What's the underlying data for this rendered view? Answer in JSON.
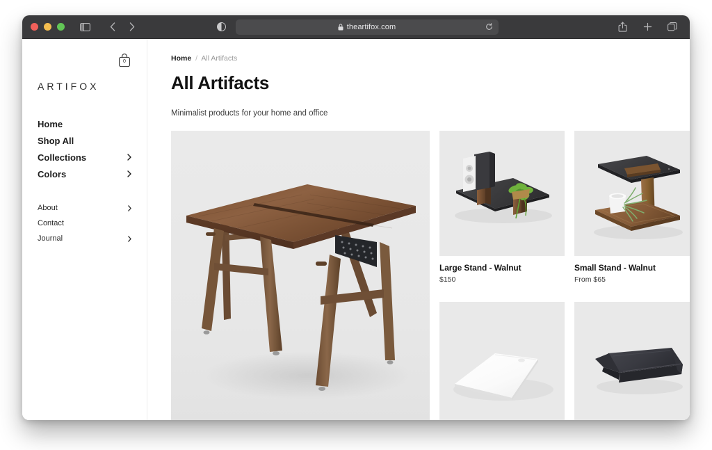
{
  "browser": {
    "window_controls": [
      "close",
      "minimize",
      "zoom"
    ],
    "sidebar_toggle_icon": "sidebar-icon",
    "back_icon": "chevron-left-icon",
    "forward_icon": "chevron-right-icon",
    "reader_icon": "reader-contrast-icon",
    "lock_icon": "lock-icon",
    "url": "theartifox.com",
    "reload_icon": "reload-icon",
    "share_icon": "share-icon",
    "new_tab_icon": "plus-icon",
    "tabs_icon": "tab-overview-icon"
  },
  "sidebar": {
    "brand": "ARTIFOX",
    "cart": {
      "icon": "shopping-bag-icon",
      "count": "0"
    },
    "primary_nav": [
      {
        "label": "Home",
        "chevron": false
      },
      {
        "label": "Shop All",
        "chevron": false
      },
      {
        "label": "Collections",
        "chevron": true
      },
      {
        "label": "Colors",
        "chevron": true
      }
    ],
    "secondary_nav": [
      {
        "label": "About",
        "chevron": true
      },
      {
        "label": "Contact",
        "chevron": false
      },
      {
        "label": "Journal",
        "chevron": true
      }
    ]
  },
  "main": {
    "breadcrumb": {
      "home": "Home",
      "separator": "/",
      "current": "All Artifacts"
    },
    "title": "All Artifacts",
    "subtitle": "Minimalist products for your home and office",
    "products": [
      {
        "image_alt": "walnut-desk",
        "name": "",
        "price": ""
      },
      {
        "image_alt": "large-stand-walnut",
        "name": "Large Stand - Walnut",
        "price": "$150"
      },
      {
        "image_alt": "small-stand-walnut",
        "name": "Small Stand - Walnut",
        "price": "From $65"
      },
      {
        "image_alt": "white-desk-mat",
        "name": "",
        "price": ""
      },
      {
        "image_alt": "black-tray-ledge",
        "name": "",
        "price": ""
      }
    ]
  },
  "colors": {
    "toolbar_bg": "#3a3a3c",
    "urlbar_bg": "#4b4b4d",
    "page_bg": "#ffffff",
    "media_bg": "#e8e8e8",
    "text_dark": "#121212",
    "text_muted": "#8e8e8e",
    "walnut": "#8a6244",
    "charcoal": "#2f3136"
  }
}
